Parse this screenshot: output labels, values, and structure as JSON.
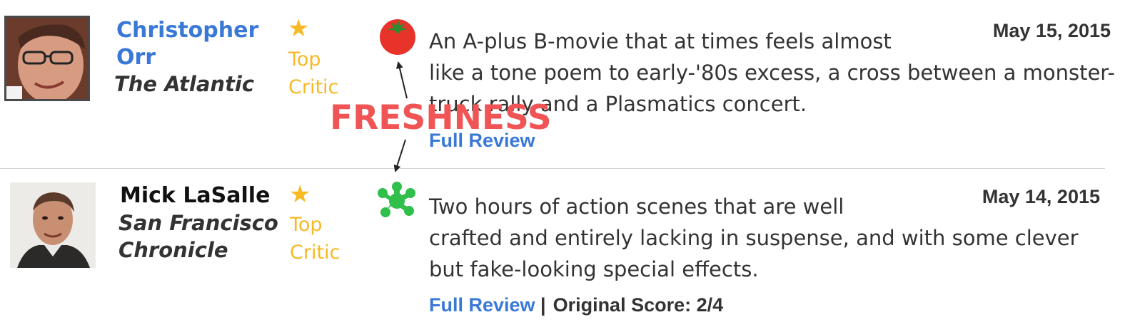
{
  "colors": {
    "link_blue": "#3a78d8",
    "top_critic_yellow": "#f7b924",
    "tomato_red": "#e8332a",
    "splat_green": "#2fbf4a",
    "annotation_red": "#f05454",
    "text_dark": "#333333"
  },
  "annotation": {
    "label": "FRESHNESS"
  },
  "reviews": [
    {
      "critic_name": "Christopher Orr",
      "publication": "The Atlantic",
      "top_critic_star": "★",
      "top_critic_label": "Top Critic",
      "freshness_icon": "fresh-tomato-icon",
      "quote_line1": "An A-plus B-movie that at times feels almost",
      "quote_rest": "like a tone poem to early-'80s excess, a cross between a monster-truck rally and a Plasmatics concert.",
      "full_review_label": "Full Review",
      "date": "May 15, 2015"
    },
    {
      "critic_name": "Mick LaSalle",
      "publication": "San Francisco Chronicle",
      "top_critic_star": "★",
      "top_critic_label": "Top Critic",
      "freshness_icon": "rotten-splat-icon",
      "quote_line1": "Two hours of action scenes that are well",
      "quote_rest": "crafted and entirely lacking in suspense, and with some clever but fake-looking special effects.",
      "full_review_label": "Full Review",
      "score_separator": "|",
      "original_score": "Original Score: 2/4",
      "date": "May 14, 2015"
    }
  ]
}
